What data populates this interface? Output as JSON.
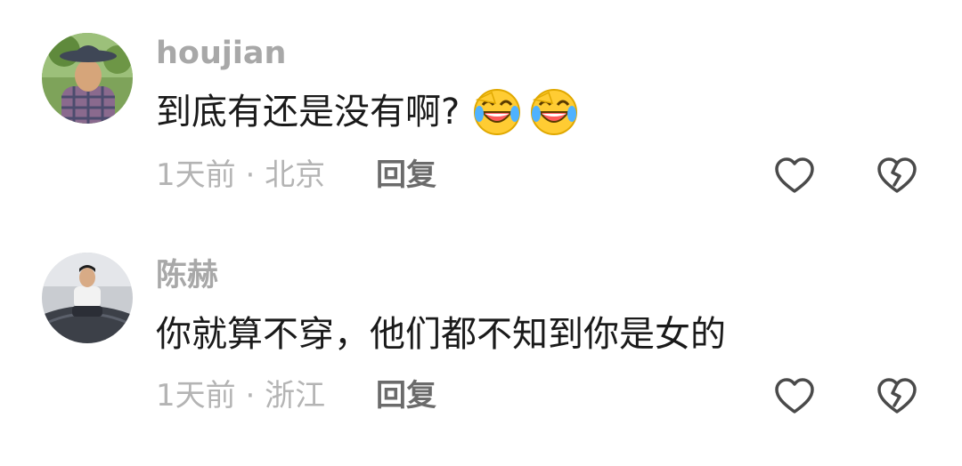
{
  "comments": [
    {
      "username": "houjian",
      "text": "到底有还是没有啊?",
      "emojis": [
        "laughing-crying-emoji",
        "laughing-crying-emoji"
      ],
      "time": "1天前",
      "separator": "·",
      "location": "北京",
      "reply_label": "回复",
      "like_icon": "heart-outline-icon",
      "dislike_icon": "broken-heart-icon"
    },
    {
      "username": "陈赫",
      "text": "你就算不穿，他们都不知到你是女的",
      "emojis": [],
      "time": "1天前",
      "separator": "·",
      "location": "浙江",
      "reply_label": "回复",
      "like_icon": "heart-outline-icon",
      "dislike_icon": "broken-heart-icon"
    }
  ],
  "colors": {
    "username": "#a8a8a8",
    "text": "#1a1a1a",
    "meta": "#b4b4b4",
    "reply": "#6b6b6b",
    "icon": "#4a4a4a"
  }
}
